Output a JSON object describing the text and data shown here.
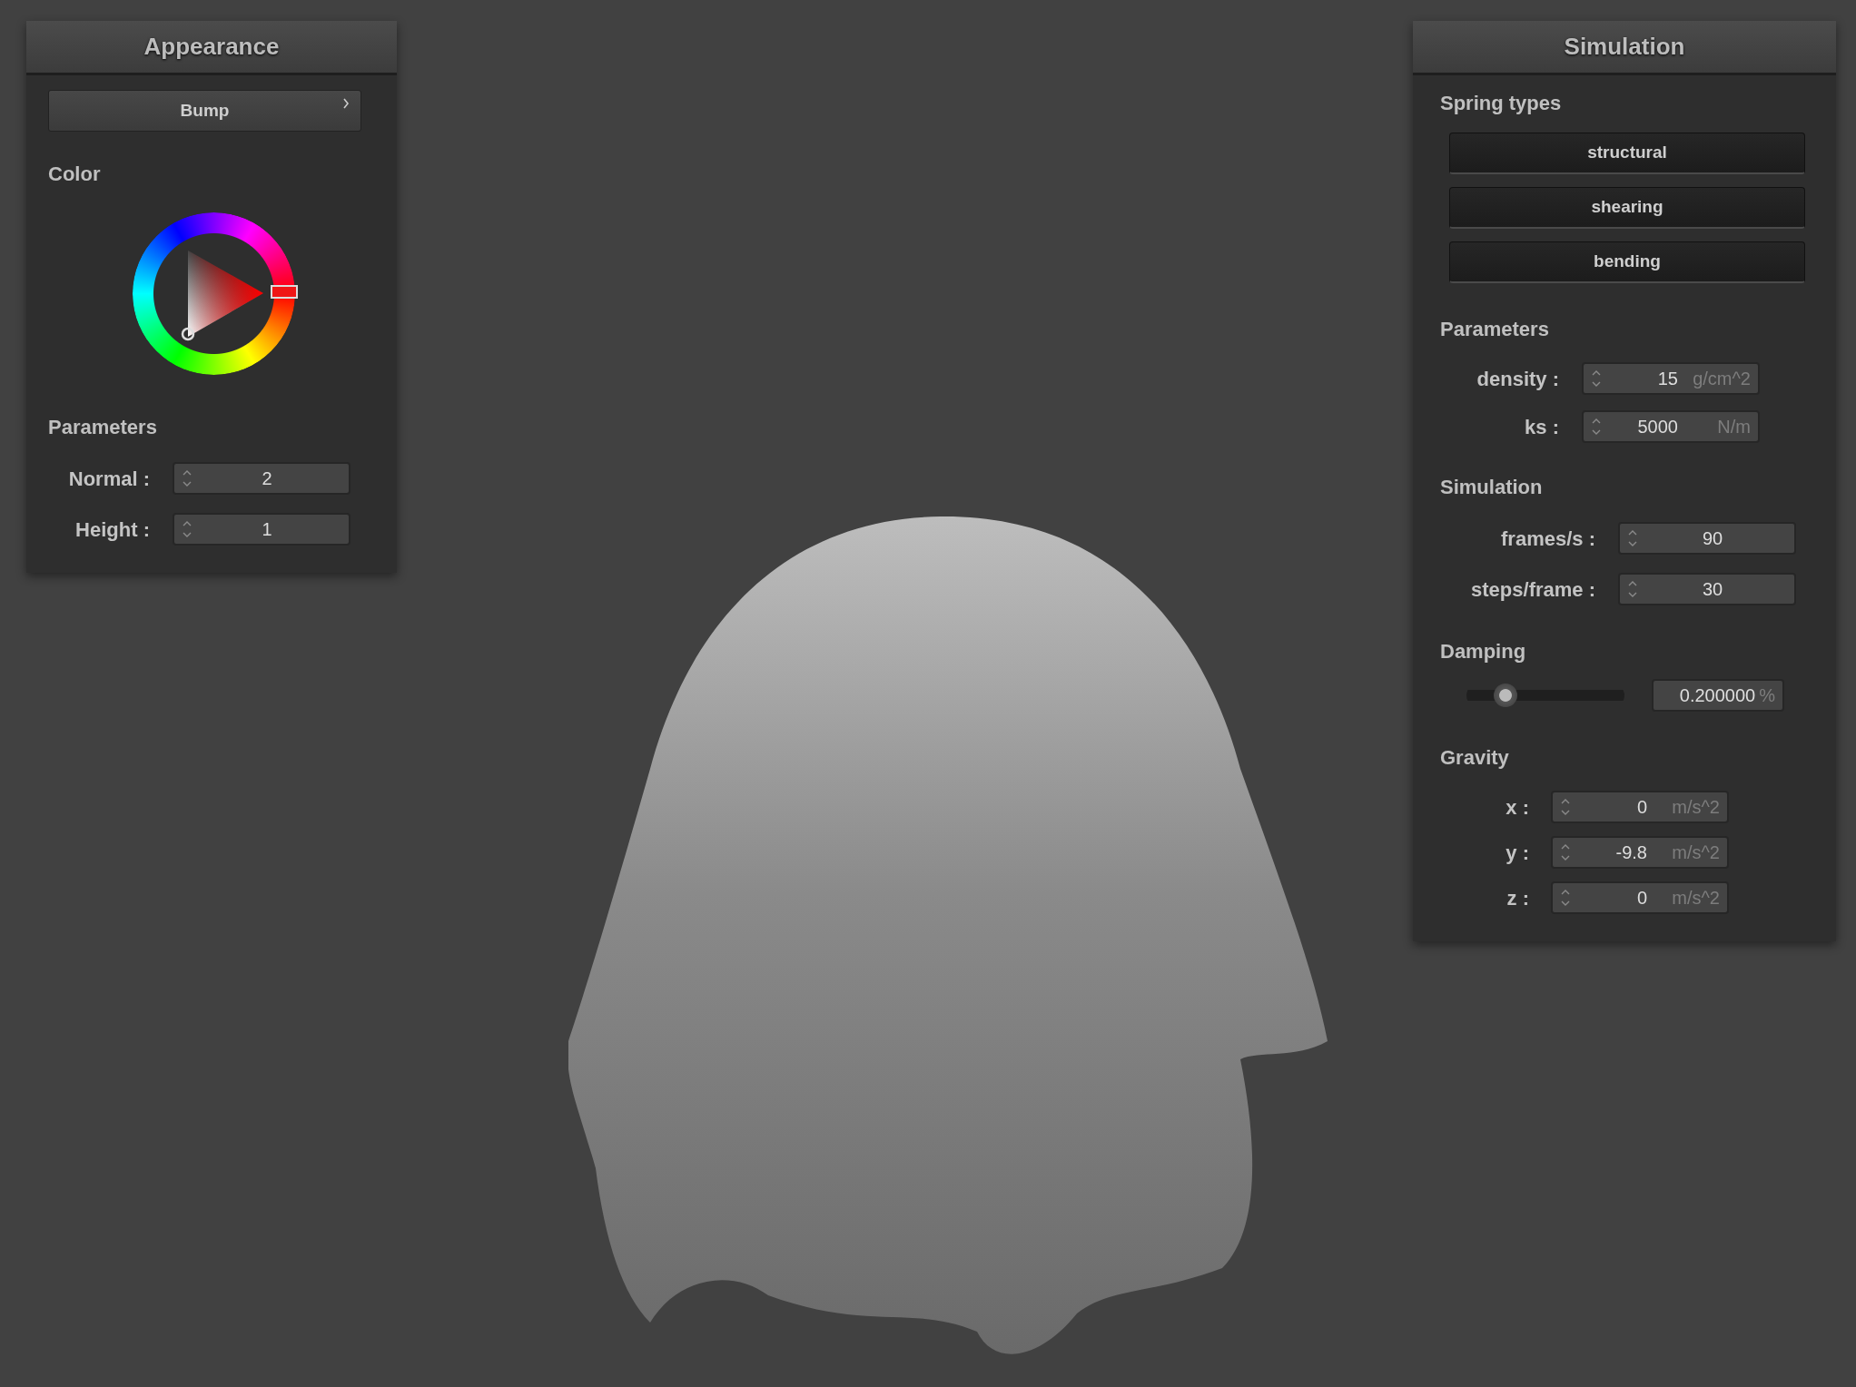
{
  "appearance": {
    "title": "Appearance",
    "mode_button": {
      "label": "Bump"
    },
    "color_label": "Color",
    "parameters_label": "Parameters",
    "fields": [
      {
        "label": "Normal :",
        "value": "2"
      },
      {
        "label": "Height :",
        "value": "1"
      }
    ]
  },
  "simulation": {
    "title": "Simulation",
    "spring_types_label": "Spring types",
    "spring_types": [
      {
        "label": "structural",
        "on": true
      },
      {
        "label": "shearing",
        "on": true
      },
      {
        "label": "bending",
        "on": true
      }
    ],
    "parameters_label": "Parameters",
    "parameters": [
      {
        "label": "density :",
        "value": "15",
        "unit": "g/cm^2"
      },
      {
        "label": "ks :",
        "value": "5000",
        "unit": "N/m"
      }
    ],
    "simulation_label": "Simulation",
    "simulation_fields": [
      {
        "label": "frames/s :",
        "value": "90"
      },
      {
        "label": "steps/frame :",
        "value": "30"
      }
    ],
    "damping_label": "Damping",
    "damping": {
      "level": 0.2,
      "value": "0.200000",
      "unit": "%"
    },
    "gravity_label": "Gravity",
    "gravity": [
      {
        "label": "x :",
        "value": "0",
        "unit": "m/s^2"
      },
      {
        "label": "y :",
        "value": "-9.8",
        "unit": "m/s^2"
      },
      {
        "label": "z :",
        "value": "0",
        "unit": "m/s^2"
      }
    ]
  }
}
